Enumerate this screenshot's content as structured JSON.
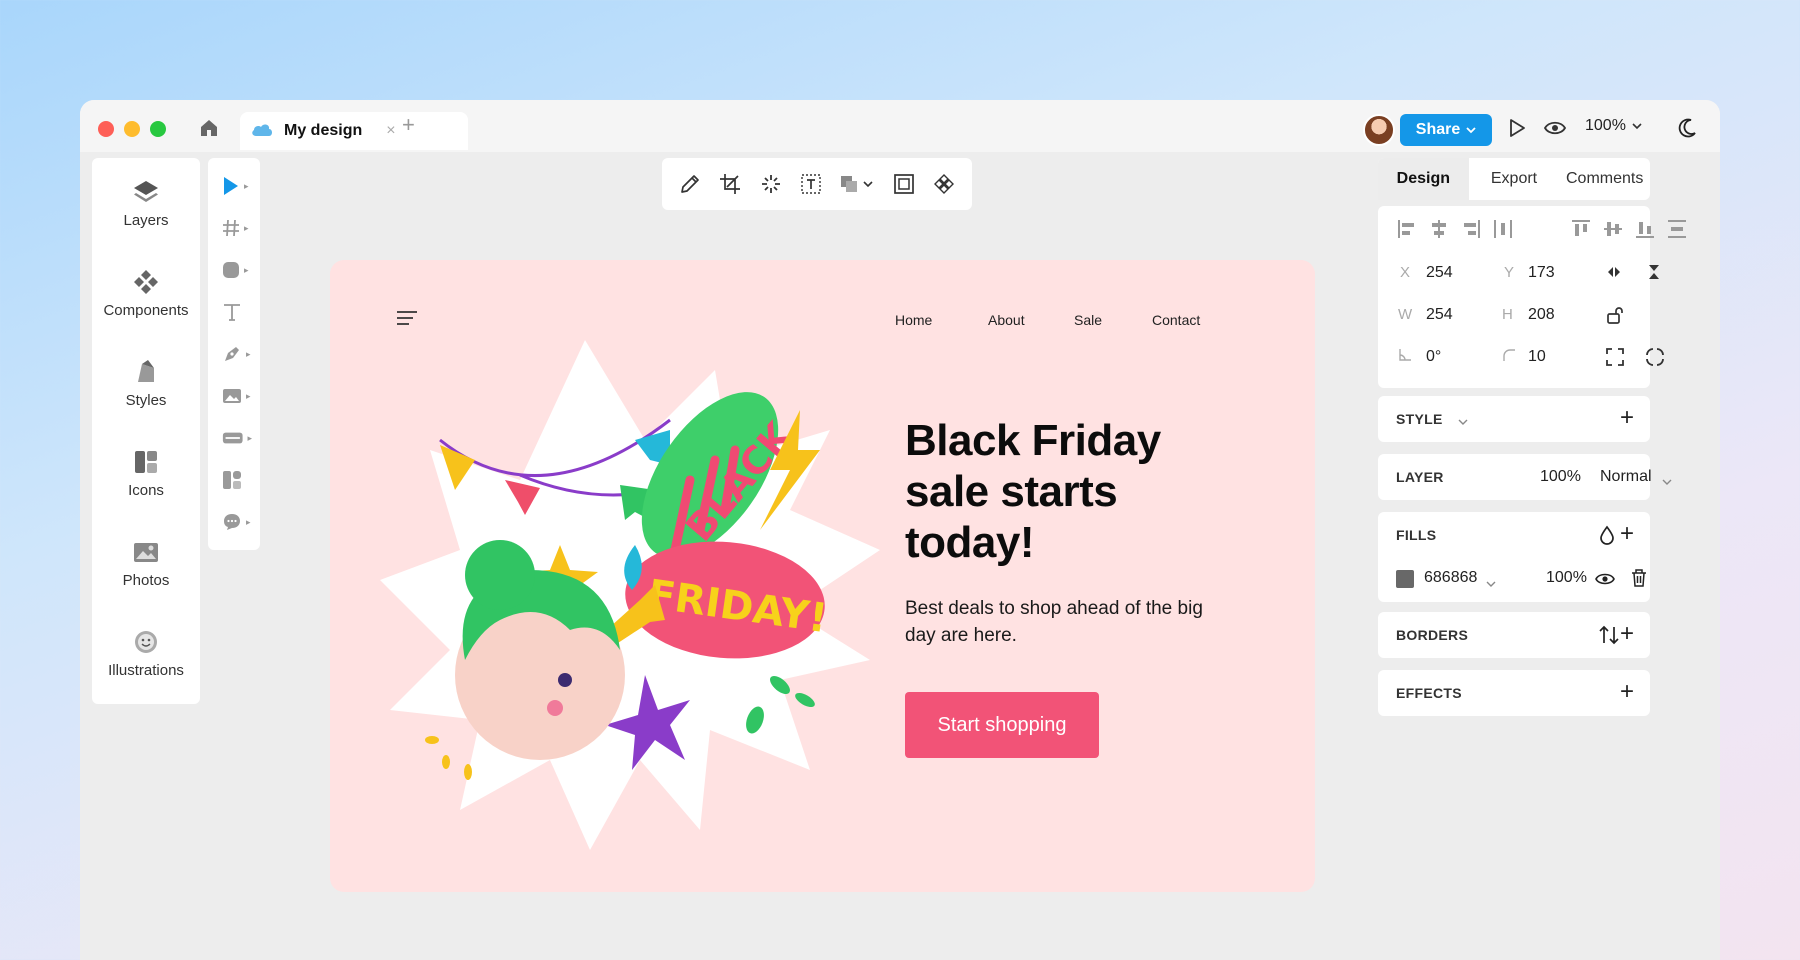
{
  "window": {
    "tab_title": "My design",
    "tab_close": "×",
    "tab_add": "+",
    "share_label": "Share",
    "zoom": "100%"
  },
  "left_panel": {
    "items": [
      {
        "label": "Layers",
        "icon": "layers-icon"
      },
      {
        "label": "Components",
        "icon": "components-icon"
      },
      {
        "label": "Styles",
        "icon": "styles-icon"
      },
      {
        "label": "Icons",
        "icon": "icons-icon"
      },
      {
        "label": "Photos",
        "icon": "photos-icon"
      },
      {
        "label": "Illustrations",
        "icon": "illustrations-icon"
      }
    ]
  },
  "artboard": {
    "nav": [
      "Home",
      "About",
      "Sale",
      "Contact"
    ],
    "headline_1": "Black Friday",
    "headline_2": "sale starts",
    "headline_3": "today!",
    "subtext": "Best deals to shop ahead of the big day are here.",
    "cta": "Start shopping",
    "illustration_text_1": "BLACK",
    "illustration_text_2": "FRIDAY!",
    "accent_color": "#f25377",
    "background_color": "#ffe2e2"
  },
  "right_panel": {
    "tabs": [
      "Design",
      "Export",
      "Comments"
    ],
    "geometry": {
      "x_label": "X",
      "x": "254",
      "y_label": "Y",
      "y": "173",
      "w_label": "W",
      "w": "254",
      "h_label": "H",
      "h": "208",
      "rotation": "0°",
      "radius": "10"
    },
    "style": {
      "title": "STYLE"
    },
    "layer": {
      "title": "LAYER",
      "opacity": "100%",
      "blend": "Normal"
    },
    "fills": {
      "title": "FILLS",
      "color_hex": "686868",
      "swatch": "#686868",
      "opacity": "100%"
    },
    "borders": {
      "title": "BORDERS"
    },
    "effects": {
      "title": "EFFECTS"
    }
  },
  "colors": {
    "share": "#1497e8"
  }
}
